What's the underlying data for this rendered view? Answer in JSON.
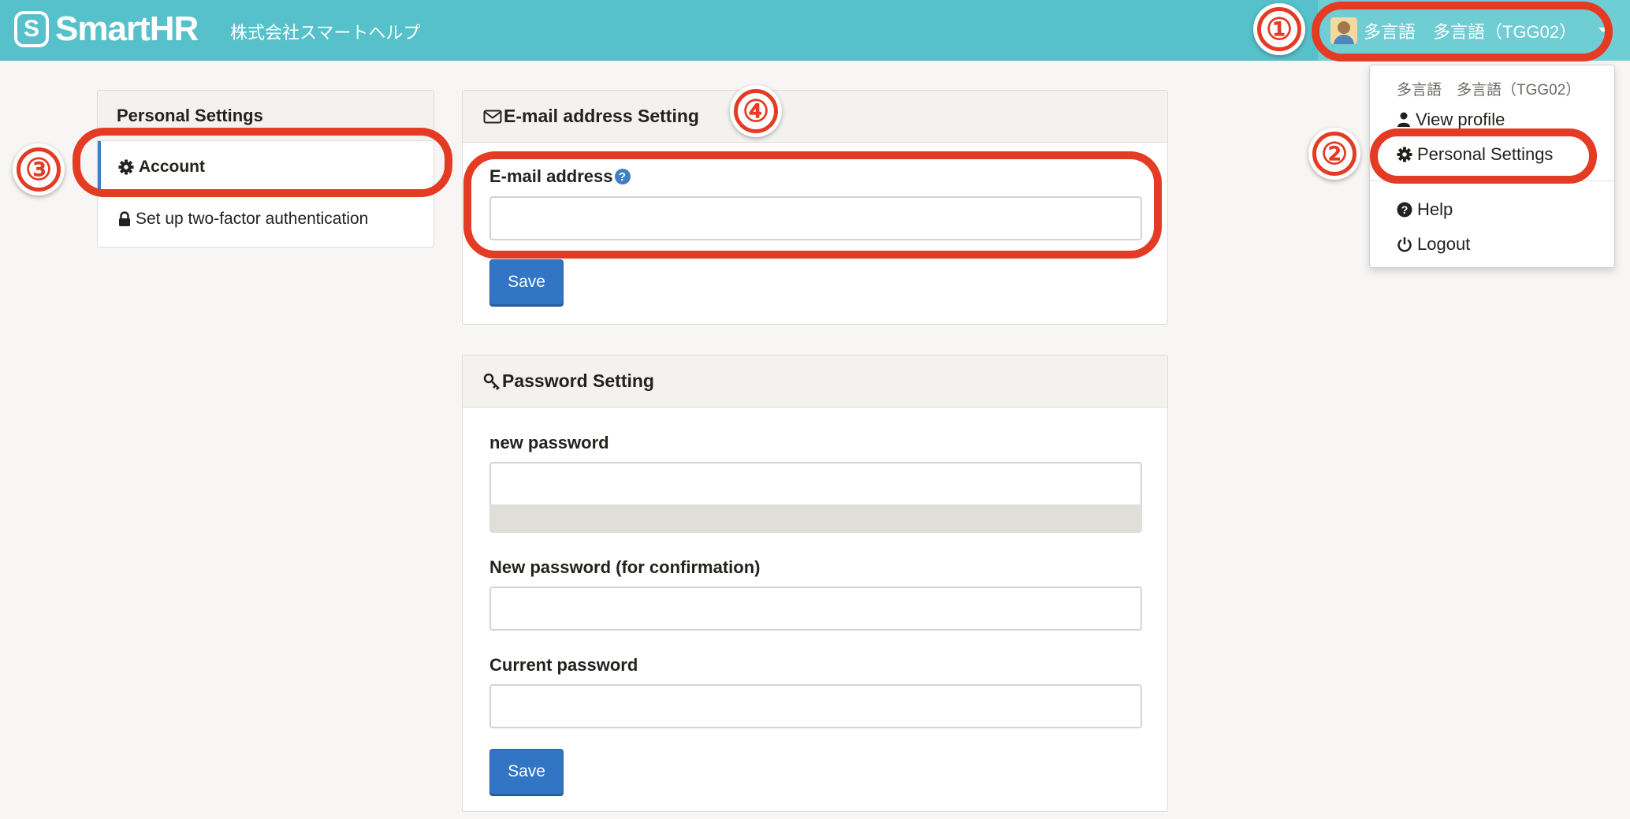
{
  "header": {
    "brand": "SmartHR",
    "company_name": "株式会社スマートヘルプ",
    "user_label": "多言語　多言語（TGG02）",
    "bg_color": "#56c1ca"
  },
  "dropdown": {
    "user_name": "多言語　多言語（TGG02）",
    "items": [
      {
        "label": "View profile",
        "icon": "user-icon"
      },
      {
        "label": "Personal Settings",
        "icon": "gear-icon"
      },
      {
        "label": "Help",
        "icon": "question-circle-icon"
      },
      {
        "label": "Logout",
        "icon": "power-icon"
      }
    ]
  },
  "sidebar": {
    "title": "Personal Settings",
    "items": [
      {
        "label": "Account",
        "icon": "gear-icon",
        "active": true
      },
      {
        "label": "Set up two-factor authentication",
        "icon": "lock-icon",
        "active": false
      }
    ]
  },
  "email_panel": {
    "title": "E-mail address Setting",
    "field_label": "E-mail address",
    "field_value": "",
    "save_label": "Save"
  },
  "password_panel": {
    "title": "Password Setting",
    "new_password_label": "new password",
    "confirm_label": "New password (for confirmation)",
    "current_label": "Current password",
    "save_label": "Save"
  },
  "annotations": {
    "step1": "①",
    "step2": "②",
    "step3": "③",
    "step4": "④",
    "color": "#e43b24"
  }
}
